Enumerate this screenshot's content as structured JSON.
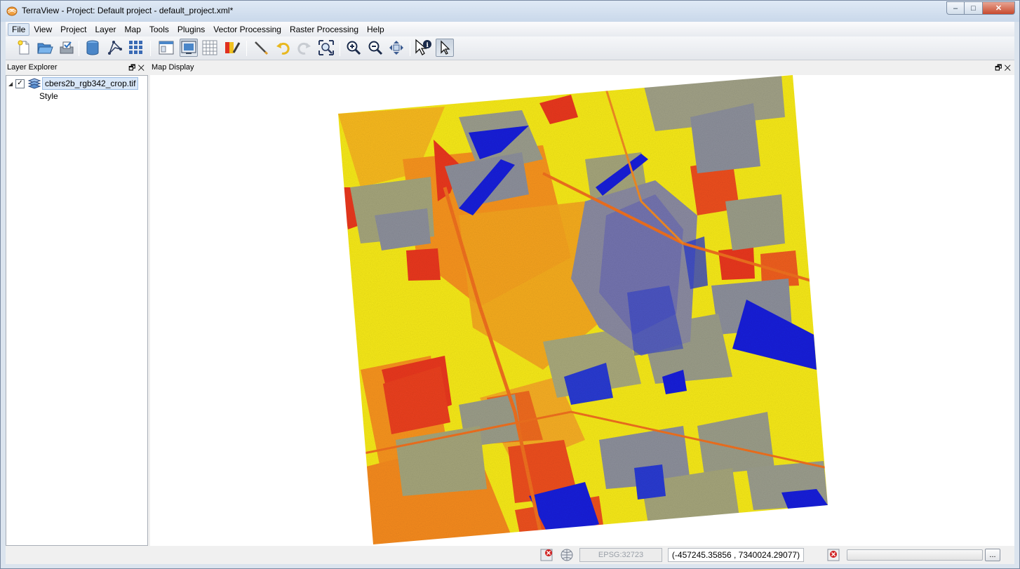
{
  "window": {
    "title": "TerraView - Project: Default project - default_project.xml*",
    "minimize_label": "‒",
    "maximize_label": "□",
    "close_label": "✕"
  },
  "menu": {
    "items": [
      {
        "label": "File",
        "active": true
      },
      {
        "label": "View"
      },
      {
        "label": "Project"
      },
      {
        "label": "Layer"
      },
      {
        "label": "Map"
      },
      {
        "label": "Tools"
      },
      {
        "label": "Plugins"
      },
      {
        "label": "Vector Processing"
      },
      {
        "label": "Raster Processing"
      },
      {
        "label": "Help"
      }
    ]
  },
  "toolbar": {
    "buttons": [
      {
        "name": "new-project-button",
        "icon": "new-document-icon"
      },
      {
        "name": "open-project-button",
        "icon": "folder-open-icon"
      },
      {
        "name": "save-project-button",
        "icon": "save-icon"
      },
      {
        "name": "add-datasource-button",
        "icon": "database-icon"
      },
      {
        "name": "add-layer-button",
        "icon": "vector-layer-icon"
      },
      {
        "name": "raster-grid-button",
        "icon": "grid-icon"
      },
      {
        "name": "layer-explorer-toggle-button",
        "icon": "layer-explorer-icon"
      },
      {
        "name": "map-display-toggle-button",
        "icon": "map-display-icon",
        "pressed": true
      },
      {
        "name": "data-table-button",
        "icon": "table-icon"
      },
      {
        "name": "style-explorer-button",
        "icon": "style-palette-icon"
      },
      {
        "name": "draw-button",
        "icon": "pencil-icon"
      },
      {
        "name": "undo-button",
        "icon": "undo-icon"
      },
      {
        "name": "redo-button",
        "icon": "redo-icon"
      },
      {
        "name": "zoom-extent-button",
        "icon": "zoom-extent-icon"
      },
      {
        "name": "zoom-in-button",
        "icon": "zoom-in-icon"
      },
      {
        "name": "zoom-out-button",
        "icon": "zoom-out-icon"
      },
      {
        "name": "pan-button",
        "icon": "pan-icon"
      },
      {
        "name": "info-button",
        "icon": "info-cursor-icon"
      },
      {
        "name": "selection-button",
        "icon": "pointer-icon",
        "pressed": true
      }
    ]
  },
  "layer_explorer": {
    "title": "Layer Explorer",
    "panel_controls": "🗗✕",
    "layer": {
      "expand_arrow": "◢",
      "check_mark": "✓",
      "name": "cbers2b_rgb342_crop.tif",
      "child": "Style"
    }
  },
  "map_display": {
    "title": "Map Display",
    "panel_controls": "🗗✕"
  },
  "status_bar": {
    "srid": "EPSG:32723",
    "coordinates": "(-457245.35856 , 7340024.29077)",
    "more_label": "..."
  },
  "colors": {
    "raster_red": "#e8371c",
    "raster_orange": "#f6931e",
    "raster_yellow": "#f5e81a",
    "raster_gray": "#8c8f9a",
    "raster_blue": "#1420d8"
  }
}
